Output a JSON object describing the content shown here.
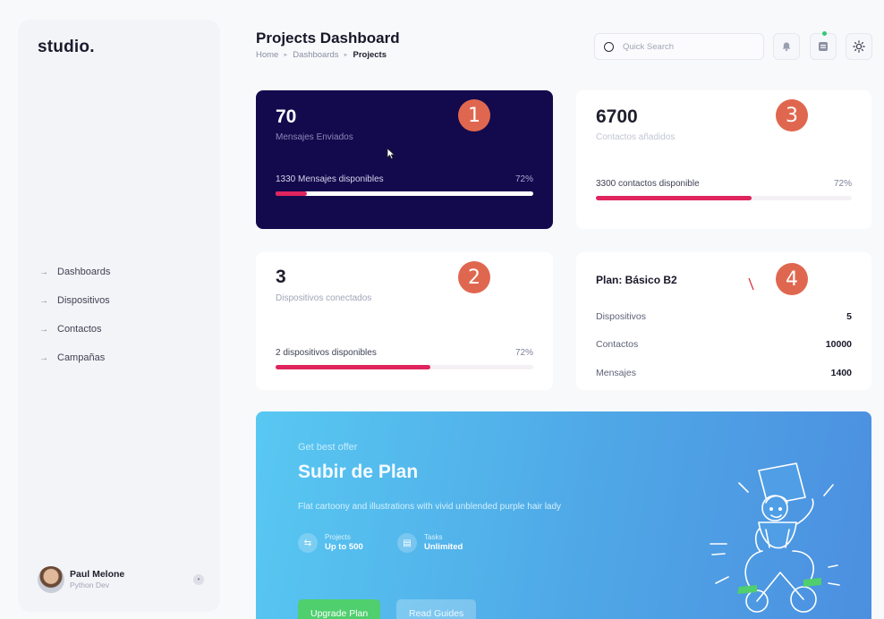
{
  "app": {
    "logo": "studio."
  },
  "sidebar": {
    "items": [
      {
        "label": "Dashboards"
      },
      {
        "label": "Dispositivos"
      },
      {
        "label": "Contactos"
      },
      {
        "label": "Campañas"
      }
    ],
    "arrow_glyph": "→"
  },
  "user": {
    "name": "Paul Melone",
    "role": "Python Dev"
  },
  "header": {
    "title": "Projects Dashboard",
    "breadcrumb": [
      "Home",
      "Dashboards",
      "Projects"
    ],
    "search_placeholder": "Quick Search"
  },
  "cards": {
    "messages": {
      "value": "70",
      "label": "Mensajes Enviados",
      "progress_label": "1330 Mensajes disponibles",
      "percent_text": "72%",
      "fill": 0.12,
      "marker": "1"
    },
    "devices": {
      "value": "3",
      "label": "Dispositivos conectados",
      "progress_label": "2 dispositivos disponibles",
      "percent_text": "72%",
      "fill": 0.6,
      "marker": "2"
    },
    "contacts": {
      "value": "6700",
      "label": "Contactos añadidos",
      "progress_label": "3300 contactos disponible",
      "percent_text": "72%",
      "fill": 0.61,
      "marker": "3"
    },
    "plan": {
      "title": "Plan: Básico B2",
      "marker": "4",
      "rows": [
        {
          "key": "Dispositivos",
          "value": "5"
        },
        {
          "key": "Contactos",
          "value": "10000"
        },
        {
          "key": "Mensajes",
          "value": "1400"
        }
      ]
    }
  },
  "banner": {
    "offer": "Get best offer",
    "title": "Subir de Plan",
    "description": "Flat cartoony and illustrations with vivid unblended purple hair lady",
    "stats": [
      {
        "label": "Projects",
        "value": "Up to 500"
      },
      {
        "label": "Tasks",
        "value": "Unlimited"
      }
    ],
    "primary_button": "Upgrade Plan",
    "secondary_button": "Read Guides"
  },
  "colors": {
    "accent": "#e0245e",
    "dark_card": "#130a4d",
    "marker": "#e0674f",
    "banner_start": "#58c8f2",
    "banner_end": "#4c8fe0",
    "green_button": "#4fcf6e"
  }
}
